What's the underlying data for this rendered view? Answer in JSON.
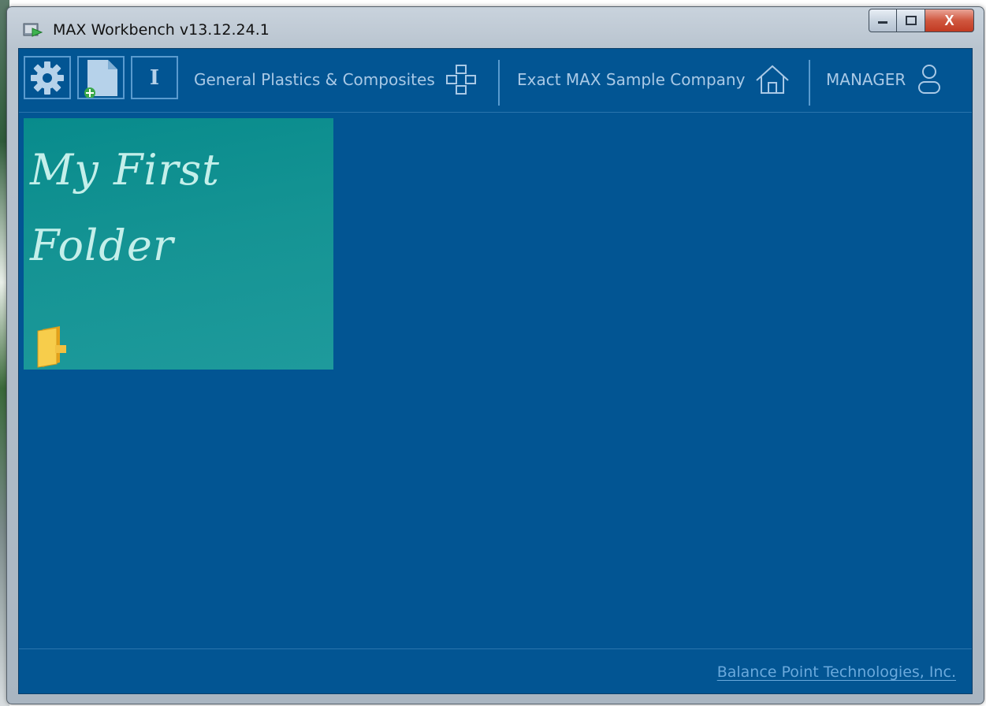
{
  "window": {
    "title": "MAX Workbench v13.12.24.1",
    "close_glyph": "X"
  },
  "toolbar": {
    "info_glyph": "I",
    "company_group": "General Plastics & Composites",
    "company": "Exact MAX Sample Company",
    "user_role": "MANAGER",
    "icons": [
      "gear-icon",
      "new-document-icon",
      "info-icon",
      "org-chart-icon",
      "home-icon",
      "user-icon"
    ]
  },
  "tiles": [
    {
      "title": "My First Folder",
      "icon": "folder-icon"
    }
  ],
  "footer": {
    "link": "Balance Point Technologies, Inc."
  },
  "colors": {
    "background": "#025593",
    "tile": "#159494",
    "toolbar_text": "#a9c9e6",
    "link": "#6aa9dc"
  }
}
